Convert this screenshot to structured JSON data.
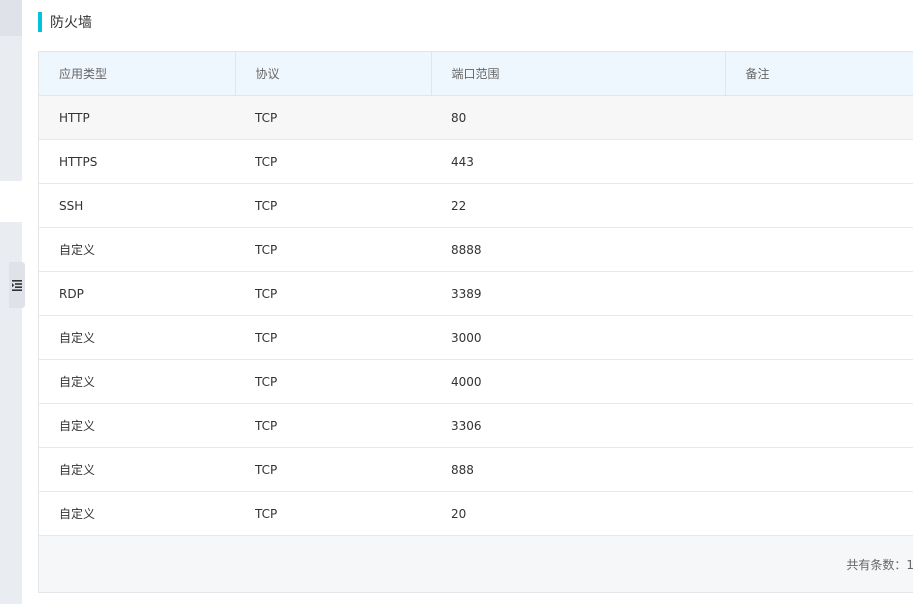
{
  "section": {
    "title": "防火墙"
  },
  "table": {
    "headers": [
      "应用类型",
      "协议",
      "端口范围",
      "备注"
    ],
    "rows": [
      {
        "app": "HTTP",
        "protocol": "TCP",
        "port": "80",
        "note": ""
      },
      {
        "app": "HTTPS",
        "protocol": "TCP",
        "port": "443",
        "note": ""
      },
      {
        "app": "SSH",
        "protocol": "TCP",
        "port": "22",
        "note": ""
      },
      {
        "app": "自定义",
        "protocol": "TCP",
        "port": "8888",
        "note": ""
      },
      {
        "app": "RDP",
        "protocol": "TCP",
        "port": "3389",
        "note": ""
      },
      {
        "app": "自定义",
        "protocol": "TCP",
        "port": "3000",
        "note": ""
      },
      {
        "app": "自定义",
        "protocol": "TCP",
        "port": "4000",
        "note": ""
      },
      {
        "app": "自定义",
        "protocol": "TCP",
        "port": "3306",
        "note": ""
      },
      {
        "app": "自定义",
        "protocol": "TCP",
        "port": "888",
        "note": ""
      },
      {
        "app": "自定义",
        "protocol": "TCP",
        "port": "20",
        "note": ""
      }
    ]
  },
  "footer": {
    "total_label": "共有条数：1"
  },
  "sidebar": {
    "collapse_icon": "list-indent-icon"
  },
  "colors": {
    "accent": "#00c1de",
    "header_bg": "#eff7fe"
  }
}
